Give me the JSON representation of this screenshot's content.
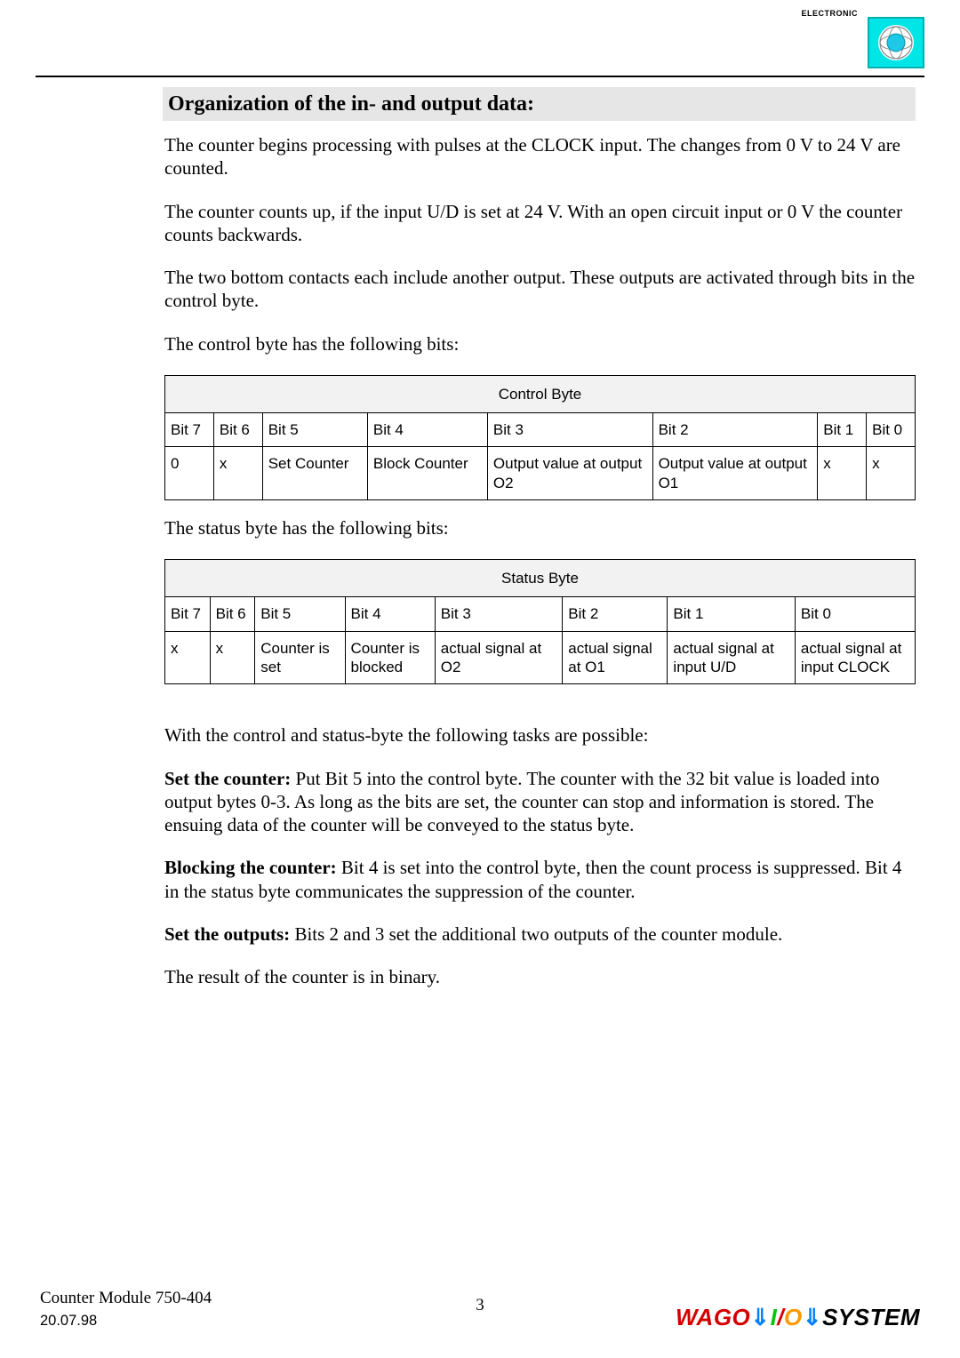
{
  "header": {
    "electronic_label": "ELECTRONIC"
  },
  "section_title": "Organization of the in- and output data:",
  "para1": "The counter begins processing with pulses at the CLOCK input. The changes from 0 V to 24 V are counted.",
  "para2": "The counter counts up, if the input U/D is set at 24 V. With an open circuit input or 0 V the counter counts backwards.",
  "para3": "The two bottom contacts each include another output. These outputs are activated through bits in the control byte.",
  "para4": "The control byte has the following bits:",
  "control_byte": {
    "title": "Control Byte",
    "headers": {
      "b7": "Bit 7",
      "b6": "Bit 6",
      "b5": "Bit 5",
      "b4": "Bit 4",
      "b3": "Bit 3",
      "b2": "Bit 2",
      "b1": "Bit 1",
      "b0": "Bit 0"
    },
    "row": {
      "b7": "0",
      "b6": "x",
      "b5": "Set Counter",
      "b4": "Block Counter",
      "b3": "Output value at output O2",
      "b2": "Output value at output O1",
      "b1": "x",
      "b0": "x"
    }
  },
  "para5": "The status byte has the following bits:",
  "status_byte": {
    "title": "Status Byte",
    "headers": {
      "b7": "Bit 7",
      "b6": "Bit 6",
      "b5": "Bit 5",
      "b4": "Bit 4",
      "b3": "Bit 3",
      "b2": "Bit 2",
      "b1": "Bit 1",
      "b0": "Bit 0"
    },
    "row": {
      "b7": "x",
      "b6": "x",
      "b5": "Counter is set",
      "b4": "Counter is blocked",
      "b3": "actual signal at O2",
      "b2": "actual signal at O1",
      "b1": "actual signal at input U/D",
      "b0": "actual signal at input CLOCK"
    }
  },
  "para6": "With the control and status-byte the following tasks are possible:",
  "set_counter_label": "Set the counter:",
  "set_counter_text": " Put Bit 5 into the control byte. The counter with the 32 bit value is loaded into output bytes 0-3. As long as the bits are set, the counter can stop and information is stored. The ensuing data of the counter will be conveyed to the status byte.",
  "block_counter_label": "Blocking the counter:",
  "block_counter_text": " Bit 4 is set into the control byte, then the count process is suppressed. Bit 4 in the status byte communicates the suppression of the counter.",
  "set_outputs_label": "Set the outputs:",
  "set_outputs_text": " Bits 2 and 3 set the additional two outputs of the counter module.",
  "para_last": "The result of the counter is in binary.",
  "footer": {
    "doc_title": "Counter Module 750-404",
    "date": "20.07.98",
    "page": "3",
    "brand_wago": "WAGO",
    "brand_i": "I",
    "brand_slash": "/",
    "brand_o": "O",
    "brand_system": "SYSTEM",
    "arrow": "⇓"
  }
}
